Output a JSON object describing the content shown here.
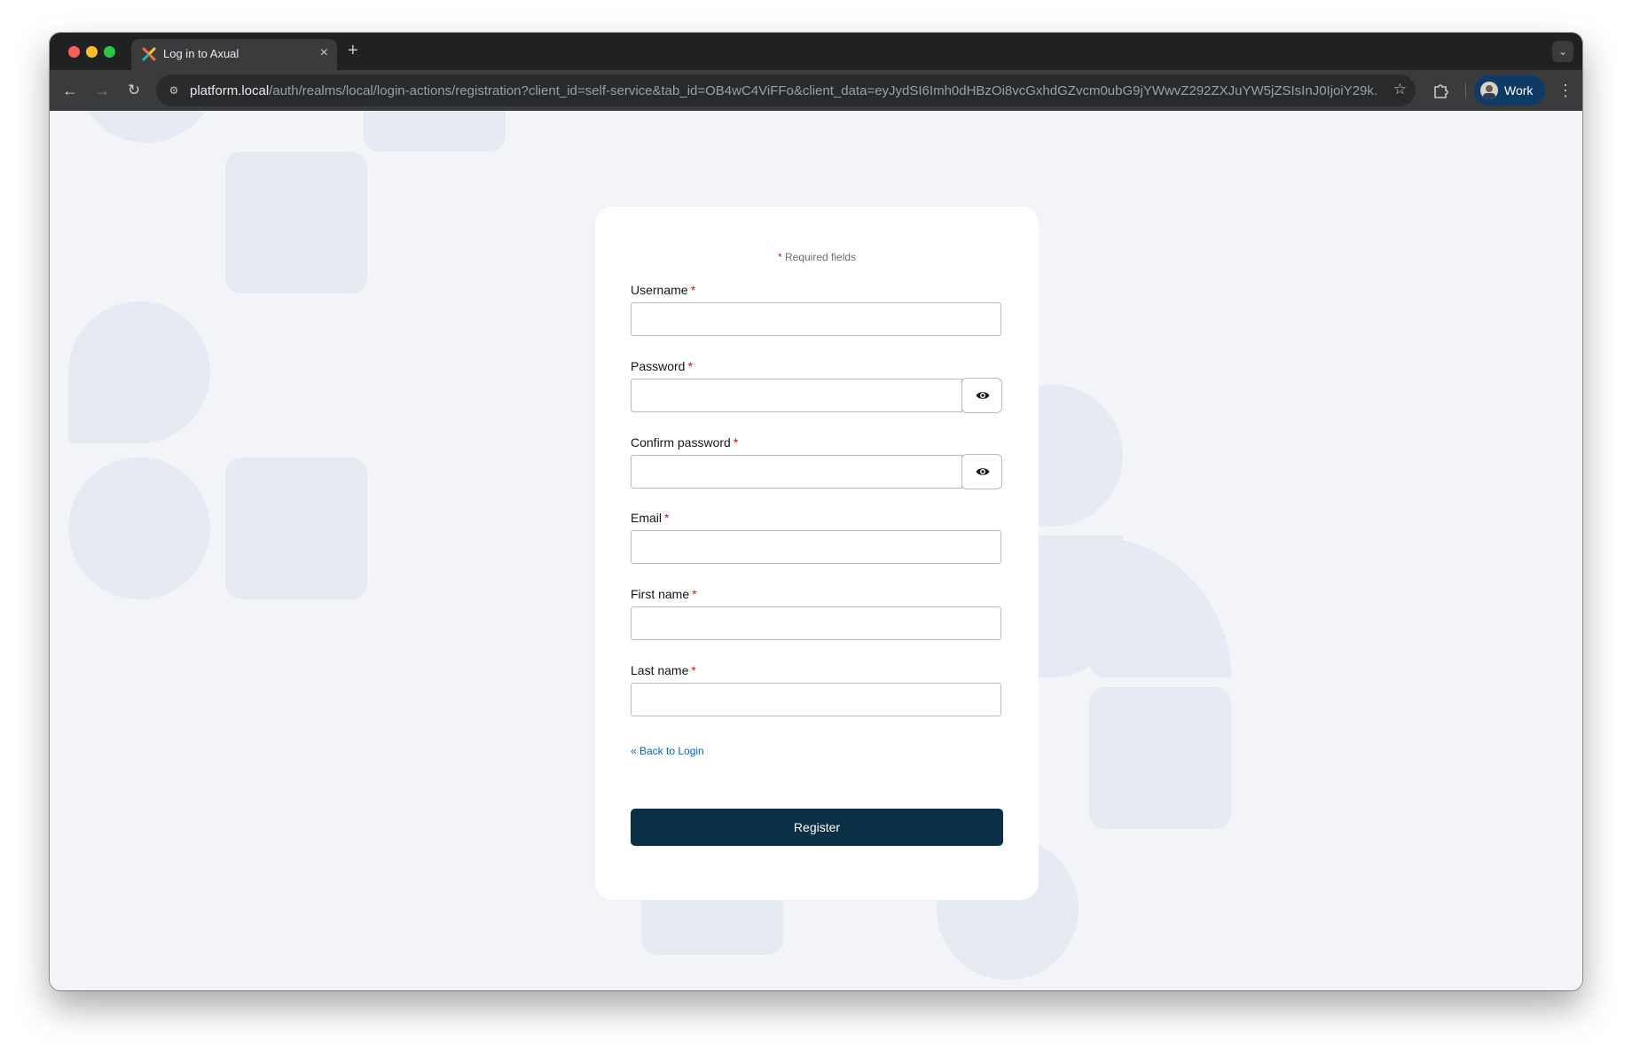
{
  "browser": {
    "tab_title": "Log in to Axual",
    "url_host": "platform.local",
    "url_path": "/auth/realms/local/login-actions/registration?client_id=self-service&tab_id=OB4wC4ViFFo&client_data=eyJydSI6Imh0dHBzOi8vcGxhdGZvcm0ubG9jYWwvZ292ZXJuYW5jZSIsInJ0IjoiY29k...",
    "profile_label": "Work",
    "icons": {
      "tab_close": "×",
      "new_tab": "+",
      "tab_search": "⌄",
      "back": "←",
      "forward": "→",
      "reload": "↻",
      "site_info": "⚙",
      "bookmark": "☆",
      "menu": "⋮"
    }
  },
  "form": {
    "required_star": "*",
    "required_note": "Required fields",
    "fields": [
      {
        "label": "Username",
        "required": "*",
        "value": ""
      },
      {
        "label": "Password",
        "required": "*",
        "value": ""
      },
      {
        "label": "Confirm password",
        "required": "*",
        "value": ""
      },
      {
        "label": "Email",
        "required": "*",
        "value": ""
      },
      {
        "label": "First name",
        "required": "*",
        "value": ""
      },
      {
        "label": "Last name",
        "required": "*",
        "value": ""
      }
    ],
    "back_link": "« Back to Login",
    "submit_label": "Register"
  },
  "colors": {
    "primary_button": "#0b2f45",
    "link": "#0066cc",
    "required": "#c9190b",
    "page_background": "#f2f4f8"
  }
}
